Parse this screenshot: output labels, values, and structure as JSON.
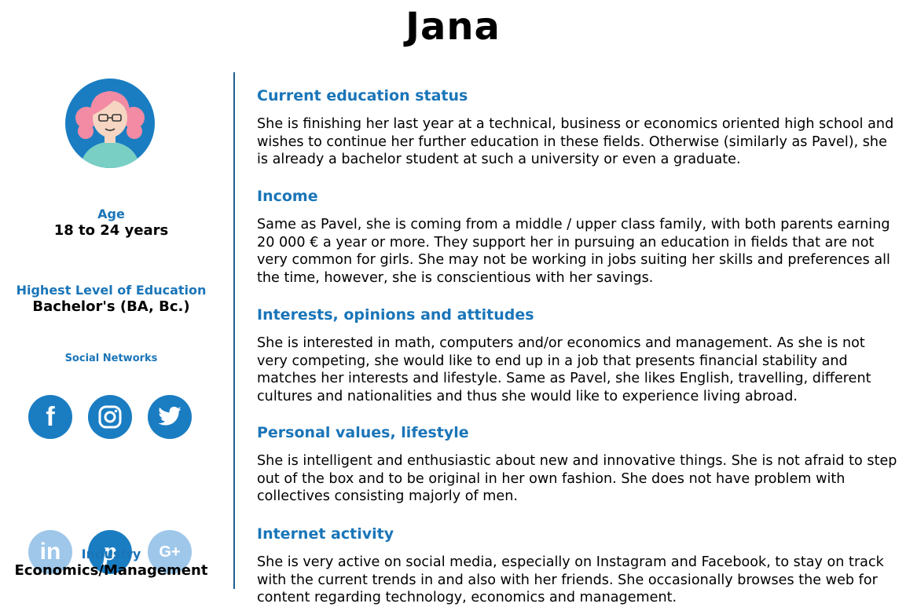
{
  "title": "Jana",
  "sidebar": {
    "age": {
      "label": "Age",
      "value": "18 to 24 years"
    },
    "education": {
      "label": "Highest Level of Education",
      "value": "Bachelor's (BA, Bc.)"
    },
    "social_networks_label": "Social Networks",
    "social_icons": [
      {
        "icon": "facebook-icon",
        "glyph": "f",
        "active": true
      },
      {
        "icon": "instagram-icon",
        "glyph": "",
        "active": true
      },
      {
        "icon": "twitter-icon",
        "glyph": "",
        "active": true
      },
      {
        "icon": "linkedin-icon",
        "glyph": "in",
        "active": false
      },
      {
        "icon": "pinterest-icon",
        "glyph": "p",
        "active": true
      },
      {
        "icon": "google-plus-icon",
        "glyph": "G+",
        "active": false
      }
    ],
    "industry": {
      "label": "Industry",
      "value": "Economics/Management"
    }
  },
  "sections": [
    {
      "heading": "Current education status",
      "text": "She is finishing her last year at a technical, business or economics oriented high school and wishes to continue her further education in these fields. Otherwise (similarly as Pavel), she is already a bachelor student at such a university or even a graduate."
    },
    {
      "heading": "Income",
      "text": "Same as Pavel, she is coming from a middle / upper class family, with both parents earning 20 000 € a year or more. They support her in pursuing an education in fields that are not very common for girls. She may not be working in jobs suiting her skills and preferences all the time, however, she is conscientious with her savings."
    },
    {
      "heading": "Interests, opinions and attitudes",
      "text": "She is interested in math, computers and/or economics and management. As she is not very competing, she would like to end up in a job that presents financial stability and matches her interests and lifestyle. Same as Pavel, she likes English, travelling, different cultures and nationalities and thus she would like to experience living abroad."
    },
    {
      "heading": "Personal values, lifestyle",
      "text": "She is intelligent and enthusiastic about new and innovative things. She is not afraid to step out of the box and to be original in her own fashion. She does not have problem with collectives consisting majorly of men."
    },
    {
      "heading": "Internet activity",
      "text": "She is very active on social media, especially on Instagram and Facebook, to stay on track with the current trends in and also with her friends. She occasionally browses the web for content regarding technology, economics and management."
    }
  ],
  "colors": {
    "accent": "#1a75b8",
    "icon_active": "#1a7dc2",
    "icon_inactive": "#9ec7ea",
    "divider": "#1f5f91"
  }
}
